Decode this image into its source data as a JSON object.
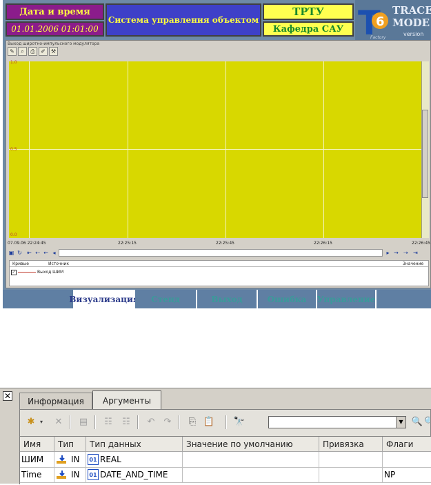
{
  "header": {
    "datetime_title": "Дата и время",
    "datetime_value": "01.01.2006 01:01:00",
    "system_title": "Система управления объектом",
    "org": "ТРТУ",
    "department": "Кафедра САУ"
  },
  "logo": {
    "letter": "T",
    "number": "6",
    "brand_line1": "TRACE",
    "brand_line2": "MODE",
    "version": "version",
    "factory": "Factory"
  },
  "trend": {
    "title": "Выход широтно-импульсного модулятора",
    "y_ticks": [
      "1.0",
      "0.5",
      "0.0"
    ],
    "x_ticks": [
      "07.09.06 22:24:45",
      "22:25:15",
      "22:25:45",
      "22:26:15",
      "22:26:45"
    ],
    "legend_headers": {
      "curves": "Кривые",
      "source": "Источник",
      "value": "Значение"
    },
    "legend_item": {
      "checked": "✓",
      "name": "Выход ШИМ"
    },
    "colors": {
      "plot_bg": "#d8d800",
      "curve": "#c0392b"
    }
  },
  "nav_tabs": [
    {
      "label": "Визуализация",
      "active": true
    },
    {
      "label": "Стенд",
      "active": false
    },
    {
      "label": "Выход",
      "active": false
    },
    {
      "label": "Ошибка",
      "active": false
    },
    {
      "label": "Управление",
      "active": false
    }
  ],
  "dialog": {
    "close": "✕",
    "tabs": {
      "info": "Информация",
      "args": "Аргументы"
    },
    "search_value": "",
    "columns": [
      "Имя",
      "Тип",
      "Тип данных",
      "Значение по умолчанию",
      "Привязка",
      "Флаги"
    ],
    "rows": [
      {
        "name": "ШИМ",
        "type": "IN",
        "data_type": "REAL",
        "default": "",
        "binding": "",
        "flags": ""
      },
      {
        "name": "Time",
        "type": "IN",
        "data_type": "DATE_AND_TIME",
        "default": "",
        "binding": "",
        "flags": "NP"
      }
    ]
  }
}
